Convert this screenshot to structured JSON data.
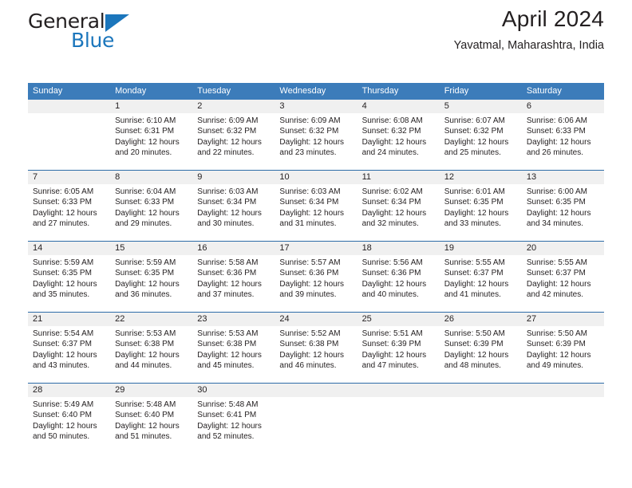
{
  "brand": {
    "name_part1": "General",
    "name_part2": "Blue",
    "accent_color": "#1b76bc"
  },
  "header": {
    "title": "April 2024",
    "location": "Yavatmal, Maharashtra, India"
  },
  "calendar": {
    "header_bg": "#3c7cba",
    "daynum_bg": "#f0f0f0",
    "weekdays": [
      "Sunday",
      "Monday",
      "Tuesday",
      "Wednesday",
      "Thursday",
      "Friday",
      "Saturday"
    ],
    "weeks": [
      [
        {
          "day": "",
          "lines": []
        },
        {
          "day": "1",
          "lines": [
            "Sunrise: 6:10 AM",
            "Sunset: 6:31 PM",
            "Daylight: 12 hours",
            "and 20 minutes."
          ]
        },
        {
          "day": "2",
          "lines": [
            "Sunrise: 6:09 AM",
            "Sunset: 6:32 PM",
            "Daylight: 12 hours",
            "and 22 minutes."
          ]
        },
        {
          "day": "3",
          "lines": [
            "Sunrise: 6:09 AM",
            "Sunset: 6:32 PM",
            "Daylight: 12 hours",
            "and 23 minutes."
          ]
        },
        {
          "day": "4",
          "lines": [
            "Sunrise: 6:08 AM",
            "Sunset: 6:32 PM",
            "Daylight: 12 hours",
            "and 24 minutes."
          ]
        },
        {
          "day": "5",
          "lines": [
            "Sunrise: 6:07 AM",
            "Sunset: 6:32 PM",
            "Daylight: 12 hours",
            "and 25 minutes."
          ]
        },
        {
          "day": "6",
          "lines": [
            "Sunrise: 6:06 AM",
            "Sunset: 6:33 PM",
            "Daylight: 12 hours",
            "and 26 minutes."
          ]
        }
      ],
      [
        {
          "day": "7",
          "lines": [
            "Sunrise: 6:05 AM",
            "Sunset: 6:33 PM",
            "Daylight: 12 hours",
            "and 27 minutes."
          ]
        },
        {
          "day": "8",
          "lines": [
            "Sunrise: 6:04 AM",
            "Sunset: 6:33 PM",
            "Daylight: 12 hours",
            "and 29 minutes."
          ]
        },
        {
          "day": "9",
          "lines": [
            "Sunrise: 6:03 AM",
            "Sunset: 6:34 PM",
            "Daylight: 12 hours",
            "and 30 minutes."
          ]
        },
        {
          "day": "10",
          "lines": [
            "Sunrise: 6:03 AM",
            "Sunset: 6:34 PM",
            "Daylight: 12 hours",
            "and 31 minutes."
          ]
        },
        {
          "day": "11",
          "lines": [
            "Sunrise: 6:02 AM",
            "Sunset: 6:34 PM",
            "Daylight: 12 hours",
            "and 32 minutes."
          ]
        },
        {
          "day": "12",
          "lines": [
            "Sunrise: 6:01 AM",
            "Sunset: 6:35 PM",
            "Daylight: 12 hours",
            "and 33 minutes."
          ]
        },
        {
          "day": "13",
          "lines": [
            "Sunrise: 6:00 AM",
            "Sunset: 6:35 PM",
            "Daylight: 12 hours",
            "and 34 minutes."
          ]
        }
      ],
      [
        {
          "day": "14",
          "lines": [
            "Sunrise: 5:59 AM",
            "Sunset: 6:35 PM",
            "Daylight: 12 hours",
            "and 35 minutes."
          ]
        },
        {
          "day": "15",
          "lines": [
            "Sunrise: 5:59 AM",
            "Sunset: 6:35 PM",
            "Daylight: 12 hours",
            "and 36 minutes."
          ]
        },
        {
          "day": "16",
          "lines": [
            "Sunrise: 5:58 AM",
            "Sunset: 6:36 PM",
            "Daylight: 12 hours",
            "and 37 minutes."
          ]
        },
        {
          "day": "17",
          "lines": [
            "Sunrise: 5:57 AM",
            "Sunset: 6:36 PM",
            "Daylight: 12 hours",
            "and 39 minutes."
          ]
        },
        {
          "day": "18",
          "lines": [
            "Sunrise: 5:56 AM",
            "Sunset: 6:36 PM",
            "Daylight: 12 hours",
            "and 40 minutes."
          ]
        },
        {
          "day": "19",
          "lines": [
            "Sunrise: 5:55 AM",
            "Sunset: 6:37 PM",
            "Daylight: 12 hours",
            "and 41 minutes."
          ]
        },
        {
          "day": "20",
          "lines": [
            "Sunrise: 5:55 AM",
            "Sunset: 6:37 PM",
            "Daylight: 12 hours",
            "and 42 minutes."
          ]
        }
      ],
      [
        {
          "day": "21",
          "lines": [
            "Sunrise: 5:54 AM",
            "Sunset: 6:37 PM",
            "Daylight: 12 hours",
            "and 43 minutes."
          ]
        },
        {
          "day": "22",
          "lines": [
            "Sunrise: 5:53 AM",
            "Sunset: 6:38 PM",
            "Daylight: 12 hours",
            "and 44 minutes."
          ]
        },
        {
          "day": "23",
          "lines": [
            "Sunrise: 5:53 AM",
            "Sunset: 6:38 PM",
            "Daylight: 12 hours",
            "and 45 minutes."
          ]
        },
        {
          "day": "24",
          "lines": [
            "Sunrise: 5:52 AM",
            "Sunset: 6:38 PM",
            "Daylight: 12 hours",
            "and 46 minutes."
          ]
        },
        {
          "day": "25",
          "lines": [
            "Sunrise: 5:51 AM",
            "Sunset: 6:39 PM",
            "Daylight: 12 hours",
            "and 47 minutes."
          ]
        },
        {
          "day": "26",
          "lines": [
            "Sunrise: 5:50 AM",
            "Sunset: 6:39 PM",
            "Daylight: 12 hours",
            "and 48 minutes."
          ]
        },
        {
          "day": "27",
          "lines": [
            "Sunrise: 5:50 AM",
            "Sunset: 6:39 PM",
            "Daylight: 12 hours",
            "and 49 minutes."
          ]
        }
      ],
      [
        {
          "day": "28",
          "lines": [
            "Sunrise: 5:49 AM",
            "Sunset: 6:40 PM",
            "Daylight: 12 hours",
            "and 50 minutes."
          ]
        },
        {
          "day": "29",
          "lines": [
            "Sunrise: 5:48 AM",
            "Sunset: 6:40 PM",
            "Daylight: 12 hours",
            "and 51 minutes."
          ]
        },
        {
          "day": "30",
          "lines": [
            "Sunrise: 5:48 AM",
            "Sunset: 6:41 PM",
            "Daylight: 12 hours",
            "and 52 minutes."
          ]
        },
        {
          "day": "",
          "lines": []
        },
        {
          "day": "",
          "lines": []
        },
        {
          "day": "",
          "lines": []
        },
        {
          "day": "",
          "lines": []
        }
      ]
    ]
  }
}
